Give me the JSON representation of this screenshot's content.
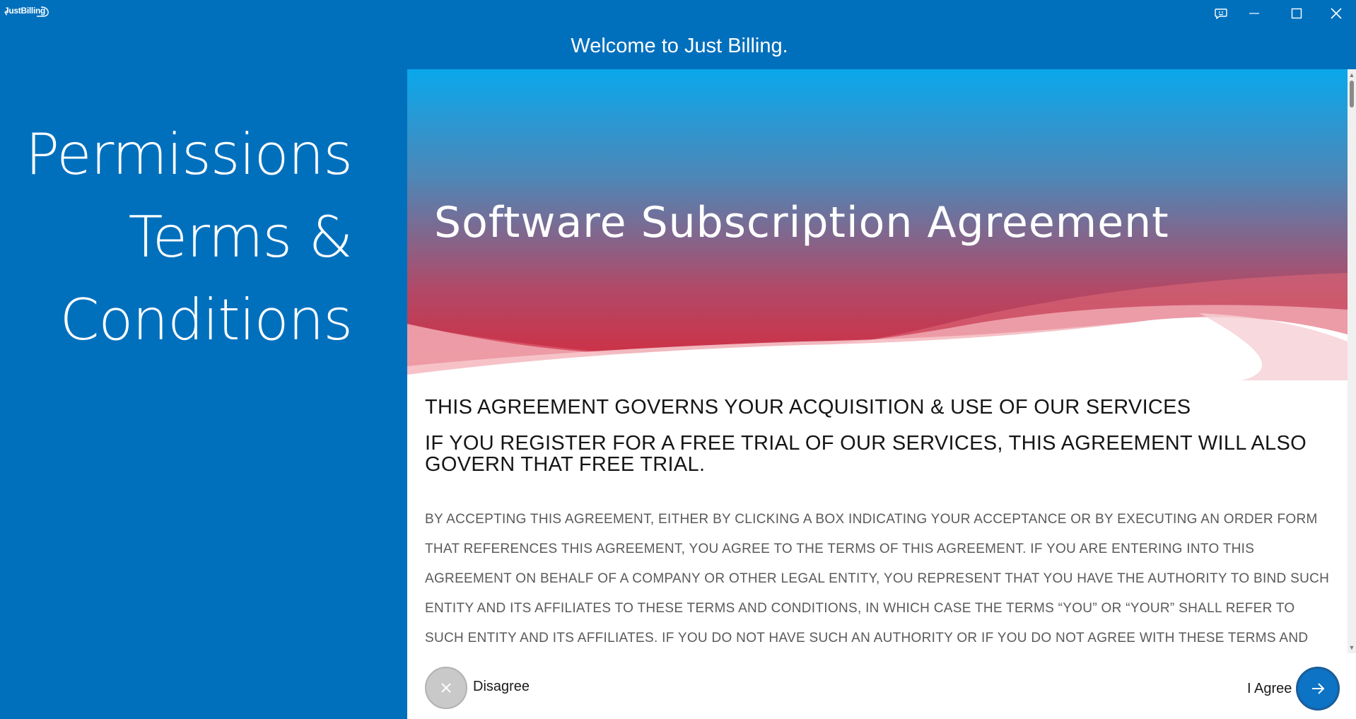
{
  "app": {
    "logo_text": "JustBilling",
    "welcome": "Welcome to Just Billing."
  },
  "window_controls": {
    "feedback_icon": "feedback-smiley-icon",
    "minimize_icon": "minimize-icon",
    "maximize_icon": "maximize-icon",
    "close_icon": "close-icon"
  },
  "sidebar": {
    "line1": "Permissions",
    "line2": "Terms &",
    "line3": "Conditions"
  },
  "hero": {
    "title": "Software Subscription Agreement"
  },
  "agreement": {
    "heading1": "THIS AGREEMENT GOVERNS YOUR ACQUISITION & USE OF OUR SERVICES",
    "heading2": "IF YOU REGISTER FOR A FREE TRIAL OF OUR SERVICES, THIS AGREEMENT WILL ALSO GOVERN THAT FREE TRIAL.",
    "body": "BY ACCEPTING THIS AGREEMENT, EITHER BY CLICKING A BOX INDICATING YOUR ACCEPTANCE OR BY EXECUTING AN ORDER FORM THAT REFERENCES THIS AGREEMENT, YOU AGREE TO THE TERMS OF THIS AGREEMENT. IF YOU ARE ENTERING INTO THIS AGREEMENT ON BEHALF OF A COMPANY OR OTHER LEGAL ENTITY, YOU REPRESENT THAT YOU HAVE THE AUTHORITY TO BIND SUCH ENTITY AND ITS AFFILIATES TO THESE TERMS AND CONDITIONS, IN WHICH CASE THE TERMS “YOU” OR “YOUR” SHALL REFER TO SUCH ENTITY AND ITS AFFILIATES. IF YOU DO NOT HAVE SUCH AN AUTHORITY OR IF YOU DO NOT AGREE WITH THESE TERMS AND CONDITIONS, YOU"
  },
  "actions": {
    "disagree_label": "Disagree",
    "agree_label": "I Agree"
  },
  "colors": {
    "brand_blue": "#0070bd",
    "agree_button": "#0d73c4",
    "disagree_button": "#c9c9c9",
    "hero_top": "#0aa8ec",
    "hero_bottom": "#d8283a"
  }
}
